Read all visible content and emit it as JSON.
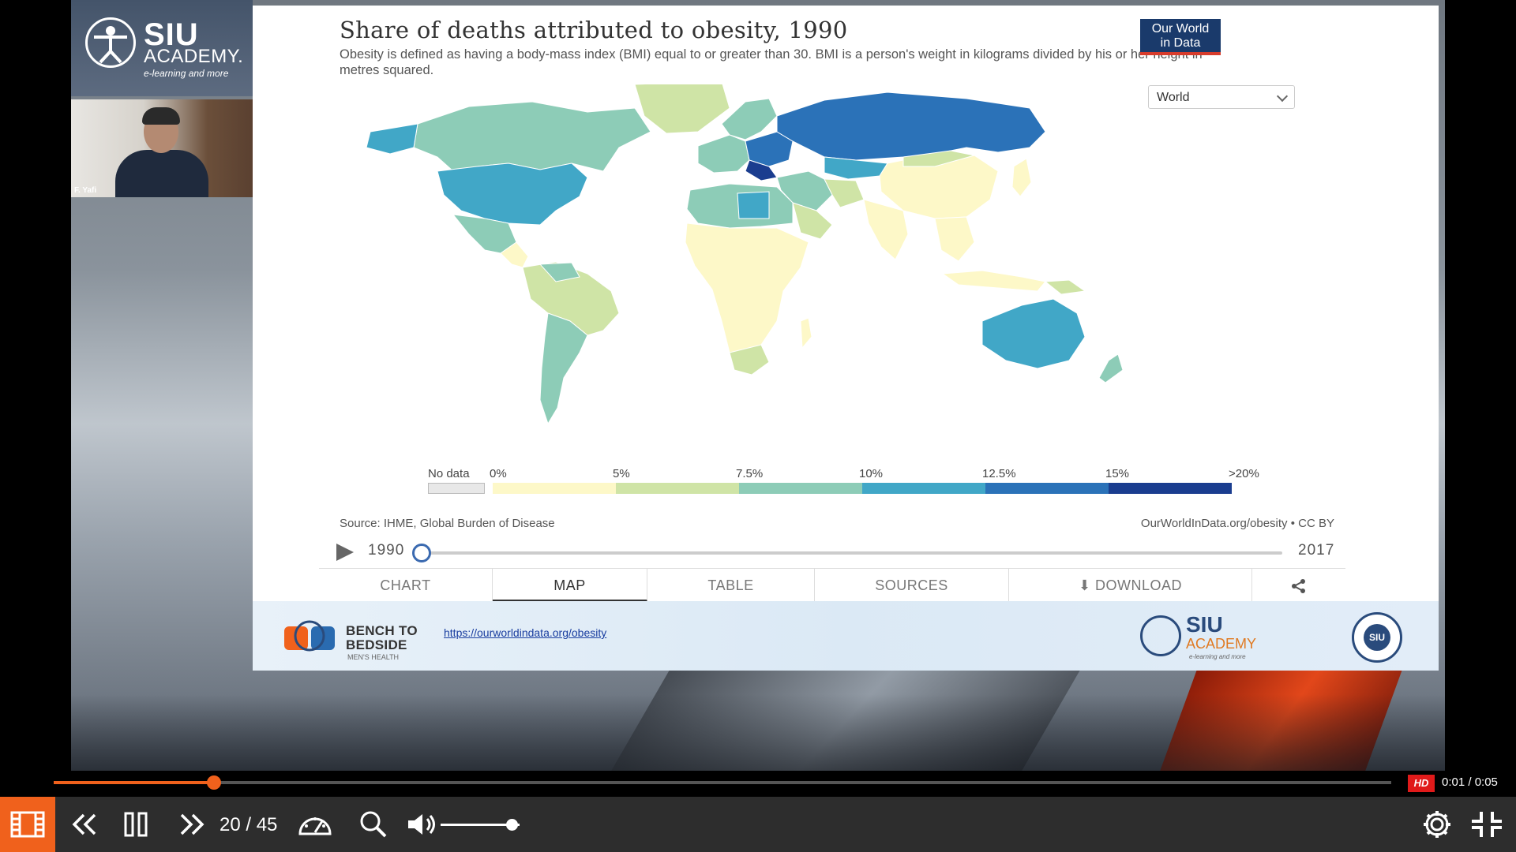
{
  "presentation": {
    "brand": {
      "line1": "SIU",
      "line2": "ACADEMY.",
      "tagline": "e-learning and more"
    },
    "speaker_name": "F. Yafi"
  },
  "chart": {
    "title": "Share of deaths attributed to obesity, 1990",
    "subtitle": "Obesity is defined as having a body-mass index (BMI) equal to or greater than 30. BMI is a person's weight in kilograms divided by his or her height in metres squared.",
    "logo_line1": "Our World",
    "logo_line2": "in Data",
    "entity_selected": "World",
    "legend": {
      "no_data_label": "No data",
      "bins": [
        {
          "label": "0%",
          "color": "#fdf8c8"
        },
        {
          "label": "5%",
          "color": "#cfe4a6"
        },
        {
          "label": "7.5%",
          "color": "#8dccb7"
        },
        {
          "label": "10%",
          "color": "#41a7c7"
        },
        {
          "label": "12.5%",
          "color": "#2b72b8"
        },
        {
          "label": "15%",
          "color": "#1a3d8f"
        }
      ],
      "end_label": ">20%"
    },
    "source": "Source: IHME, Global Burden of Disease",
    "credit": "OurWorldInData.org/obesity • CC BY",
    "timeline": {
      "start_year": "1990",
      "end_year": "2017",
      "position": 0.0
    },
    "tabs": [
      {
        "label": "CHART",
        "active": false
      },
      {
        "label": "MAP",
        "active": true
      },
      {
        "label": "TABLE",
        "active": false
      },
      {
        "label": "SOURCES",
        "active": false
      },
      {
        "label": "DOWNLOAD",
        "active": false
      }
    ]
  },
  "footer": {
    "b2b_line1": "BENCH TO",
    "b2b_line2": "BEDSIDE",
    "b2b_line3": "MEN'S HEALTH",
    "link": "https://ourworldindata.org/obesity",
    "siu_line1": "SIU",
    "siu_line2": "ACADEMY",
    "siu_line3": "e-learning and more",
    "seal_text": "SIU"
  },
  "player": {
    "progress_fraction": 0.12,
    "hd_label": "HD",
    "time": "0:01 / 0:05",
    "slide_counter": "20 / 45",
    "volume_fraction": 0.9,
    "icons": {
      "slides": "film-icon",
      "prev": "double-chevron-left-icon",
      "pause": "pause-icon",
      "next": "double-chevron-right-icon",
      "speed": "speedometer-icon",
      "search": "search-icon",
      "volume": "volume-icon",
      "settings": "gear-icon",
      "fullscreen": "exit-fullscreen-icon"
    },
    "accent_color": "#f0611c"
  }
}
